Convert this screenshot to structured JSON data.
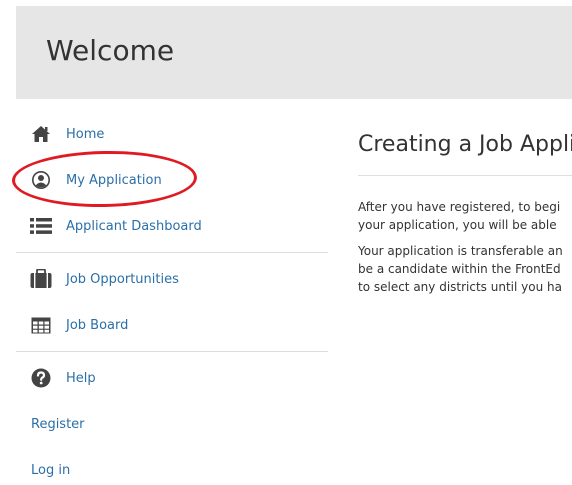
{
  "header": {
    "title": "Welcome"
  },
  "sidebar": {
    "items": [
      {
        "label": "Home",
        "icon": "home-icon"
      },
      {
        "label": "My Application",
        "icon": "user-circle-icon"
      },
      {
        "label": "Applicant Dashboard",
        "icon": "list-icon"
      },
      {
        "label": "Job Opportunities",
        "icon": "briefcase-icon"
      },
      {
        "label": "Job Board",
        "icon": "table-icon"
      },
      {
        "label": "Help",
        "icon": "question-circle-icon"
      },
      {
        "label": "Register"
      },
      {
        "label": "Log in"
      }
    ]
  },
  "main": {
    "title": "Creating a Job Appli",
    "paragraphs": [
      [
        "After you have registered, to begi",
        "your application, you will be able"
      ],
      [
        "Your application is transferable an",
        "be a candidate within the FrontEd",
        "to select any districts until you ha"
      ]
    ]
  },
  "colors": {
    "link": "#2a6fa8",
    "highlight": "#e01a22",
    "header_bg": "#e6e6e6"
  }
}
